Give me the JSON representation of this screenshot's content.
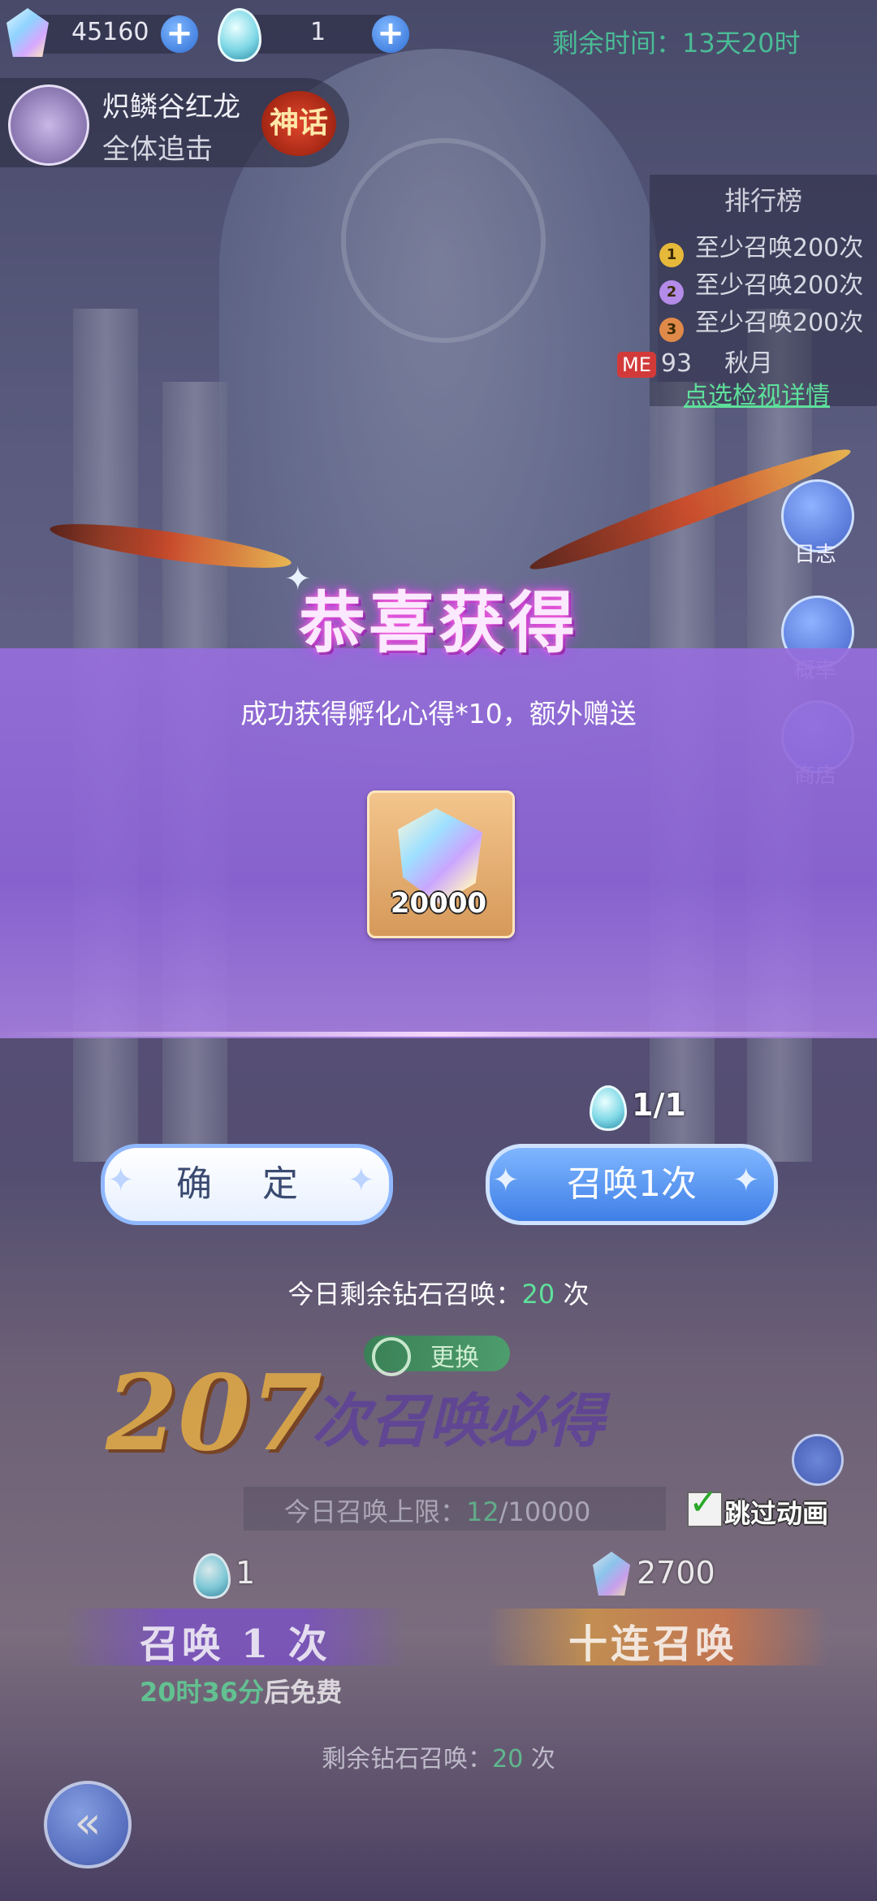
{
  "top_bar": {
    "diamond_count": "45160",
    "egg_count": "1",
    "remaining_time_label": "剩余时间：",
    "remaining_time_value": "13天20时"
  },
  "banner": {
    "dragon_name": "炽鳞谷红龙",
    "subtitle": "全体追击",
    "rarity_badge": "神话"
  },
  "ranking": {
    "title": "排行榜",
    "rows": [
      {
        "rank": "1",
        "text": "至少召唤200次",
        "color": "#e6b93a"
      },
      {
        "rank": "2",
        "text": "至少召唤200次",
        "color": "#b48be8"
      },
      {
        "rank": "3",
        "text": "至少召唤200次",
        "color": "#e08a4a"
      }
    ],
    "me_badge": "ME",
    "me_rank": "93",
    "me_name": "秋月",
    "detail_link": "点选检视详情"
  },
  "side_menu": {
    "log": "日志",
    "probability": "概率",
    "shop": "商店"
  },
  "popup": {
    "title": "恭喜获得",
    "message": "成功获得孵化心得*10，额外赠送",
    "item_count": "20000",
    "confirm_label": "确 定",
    "summon_label": "召唤1次",
    "summon_cost": "1/1"
  },
  "daily_remaining": {
    "prefix": "今日剩余钻石召唤：",
    "value": "20",
    "suffix": " 次"
  },
  "lower": {
    "swap_label": "更换",
    "guarantee_number": "207",
    "guarantee_text": "次召唤必得",
    "limit_prefix": "今日召唤上限：",
    "limit_used": "12",
    "limit_total": "/10000",
    "skip_label": "跳过动画",
    "single_cost": "1",
    "ten_cost": "2700",
    "single_label": "召唤 1 次",
    "ten_label": "十连召唤",
    "free_time": "20时36分",
    "free_suffix": "后免费",
    "remain_prefix": "剩余钻石召唤：",
    "remain_value": "20",
    "remain_suffix": " 次"
  },
  "colors": {
    "accent_green": "#5ee09a",
    "summon_blue": "#3f7fe6",
    "popup_purple": "#966edc"
  }
}
